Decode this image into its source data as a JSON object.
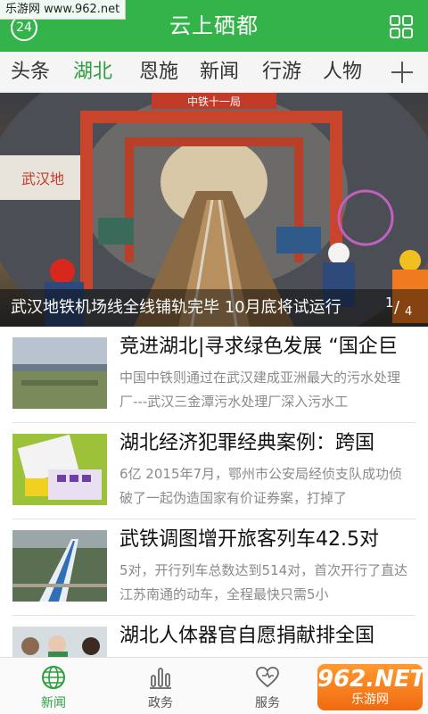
{
  "watermark_top": "乐游网 www.962.net",
  "header": {
    "weather_value": "24",
    "title": "云上硒都",
    "grid_icon": "grid-icon"
  },
  "tabs": [
    {
      "label": "头条",
      "active": false
    },
    {
      "label": "湖北",
      "active": true
    },
    {
      "label": "恩施",
      "active": false
    },
    {
      "label": "新闻",
      "active": false
    },
    {
      "label": "行游",
      "active": false
    },
    {
      "label": "人物",
      "active": false
    }
  ],
  "tab_add_icon": "plus-icon",
  "banner": {
    "sign_text": "中铁十一局",
    "side_text": "武汉地",
    "caption": "武汉地铁机场线全线铺轨完毕 10月底将试运行",
    "page_current": "1",
    "page_total": "4"
  },
  "news": [
    {
      "title": "竞进湖北|寻求绿色发展 “国企巨",
      "desc": "中国中铁则通过在武汉建成亚洲最大的污水处理厂---武汉三金潭污水处理厂深入污水工"
    },
    {
      "title": "湖北经济犯罪经典案例：跨国",
      "desc": "6亿 2015年7月，鄂州市公安局经侦支队成功侦破了一起伪造国家有价证券案，打掉了"
    },
    {
      "title": "武铁调图增开旅客列车42.5对",
      "desc": "5对，开行列车总数达到514对，首次开行了直达江苏南通的动车，全程最快只需5小"
    },
    {
      "title": "湖北人体器官自愿捐献排全国",
      "desc": ""
    }
  ],
  "bottom_nav": [
    {
      "label": "新闻",
      "icon": "globe-icon",
      "active": true
    },
    {
      "label": "政务",
      "icon": "bar-chart-icon",
      "active": false
    },
    {
      "label": "服务",
      "icon": "heart-icon",
      "active": false
    },
    {
      "label": "",
      "icon": "",
      "active": false
    }
  ],
  "watermark_bottom": {
    "big": "962.NET",
    "small": "乐游网"
  },
  "colors": {
    "brand_green": "#33b34a",
    "active_tab": "#2e9f3e"
  }
}
